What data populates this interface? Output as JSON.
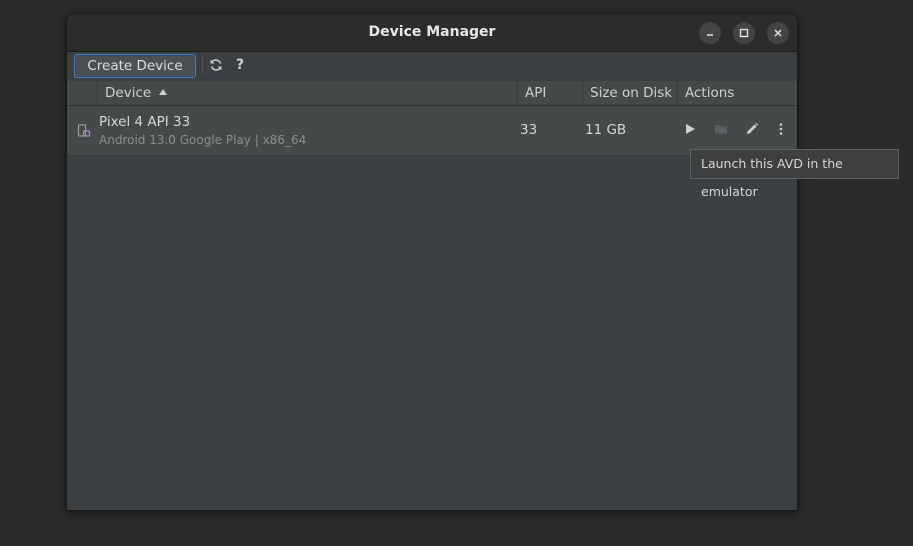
{
  "window": {
    "title": "Device Manager"
  },
  "toolbar": {
    "create_label": "Create Device",
    "help_label": "?"
  },
  "table": {
    "columns": [
      "Device",
      "API",
      "Size on Disk",
      "Actions"
    ],
    "rows": [
      {
        "name": "Pixel 4 API 33",
        "subtitle": "Android 13.0 Google Play | x86_64",
        "api": "33",
        "size": "11 GB"
      }
    ]
  },
  "tooltip": {
    "text": "Launch this AVD in the emulator"
  },
  "icons": {
    "refresh": "refresh-icon",
    "launch": "play-icon",
    "folder": "folder-icon",
    "edit": "pencil-icon",
    "more": "more-vertical-icon",
    "device": "phone-icon"
  },
  "colors": {
    "accent": "#4a7cb3",
    "device_icon": "#a58bd1"
  }
}
